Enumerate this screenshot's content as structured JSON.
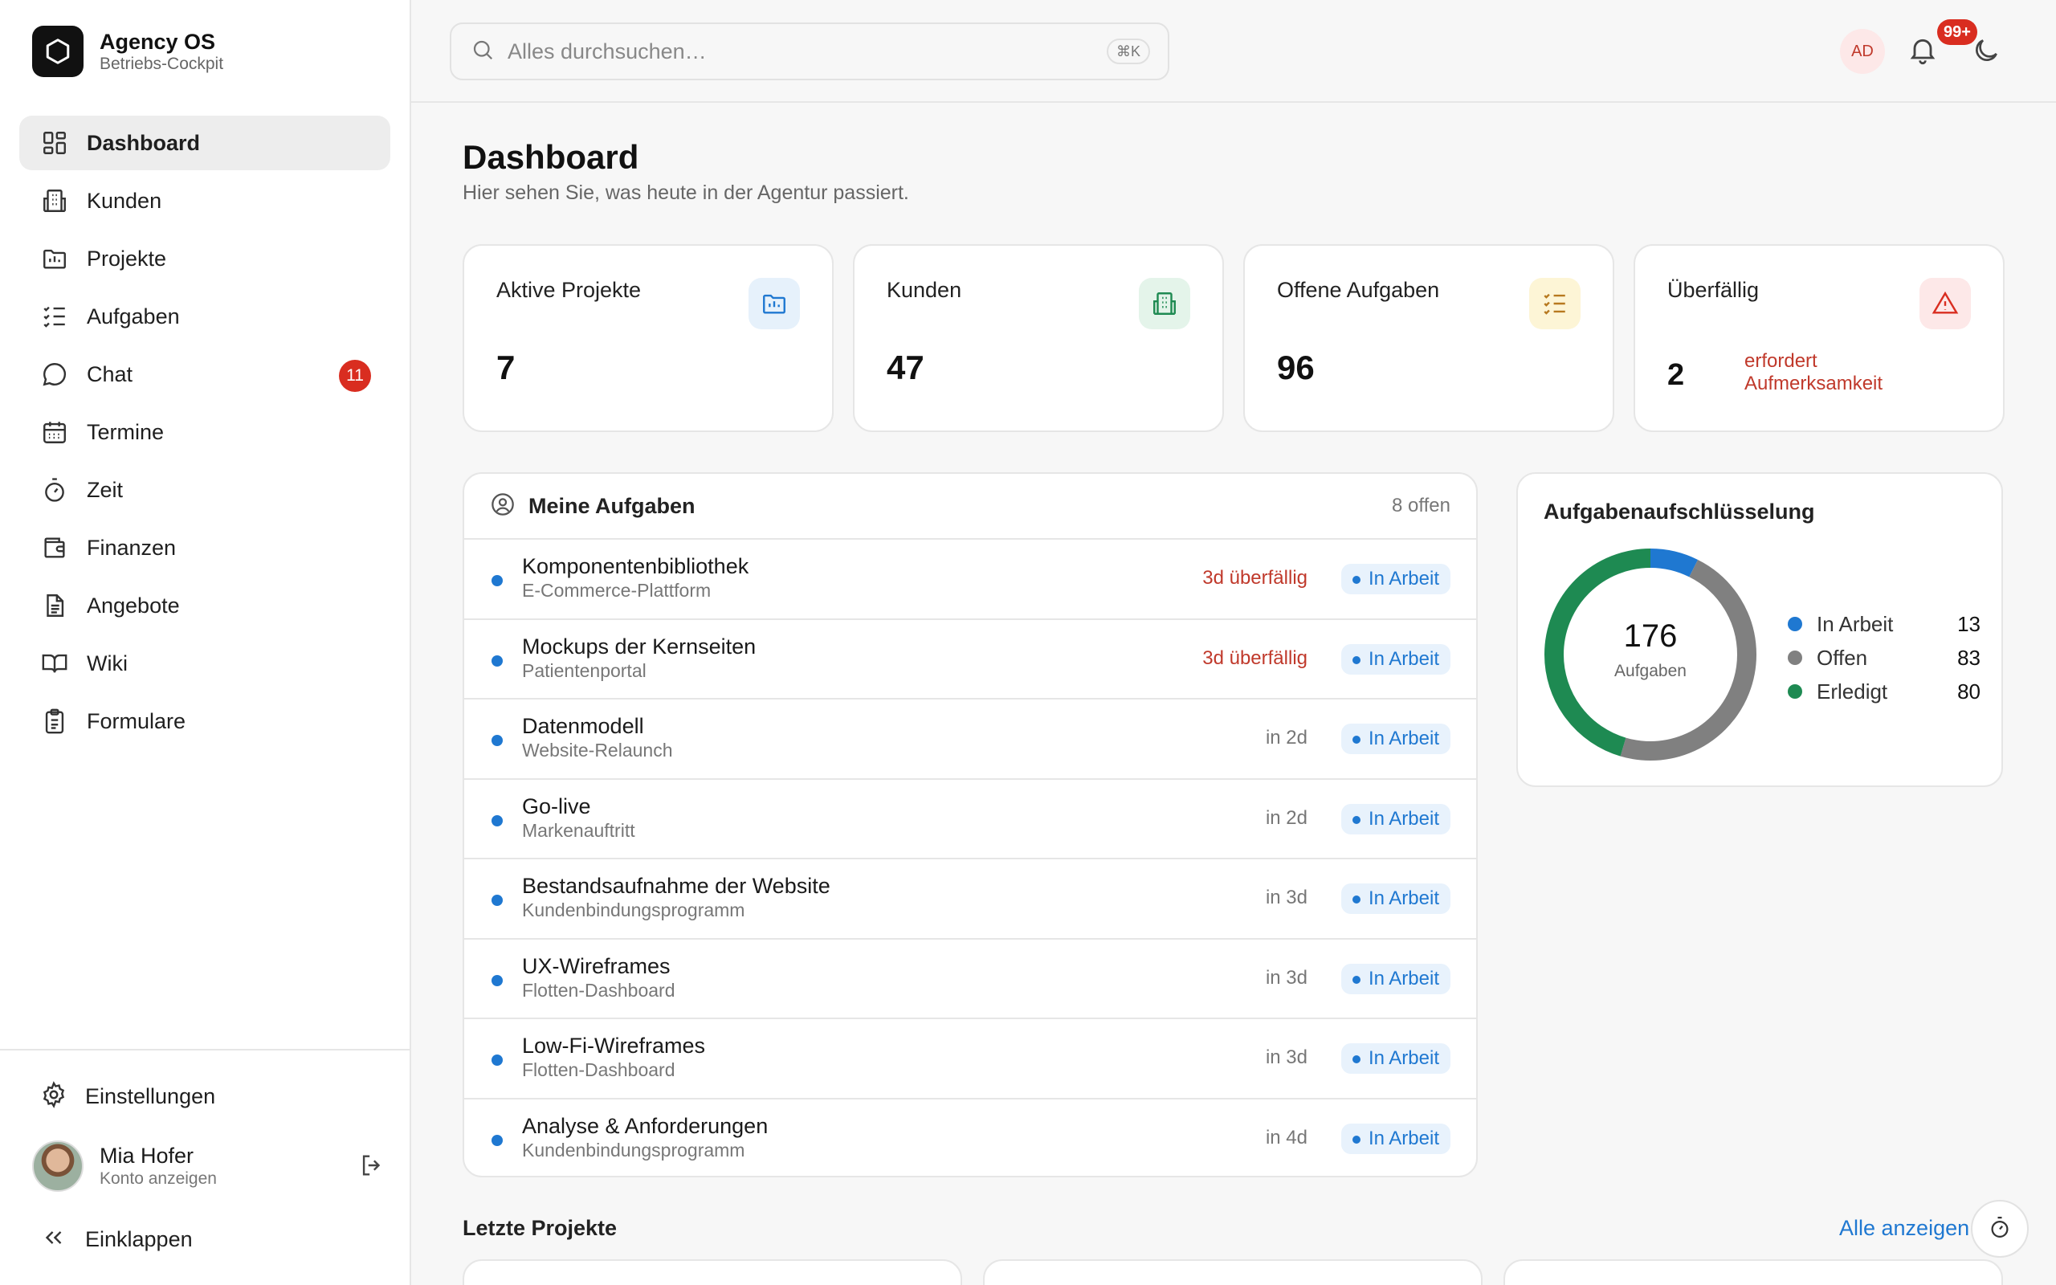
{
  "brand": {
    "name": "Agency OS",
    "subtitle": "Betriebs-Cockpit"
  },
  "nav": {
    "items": [
      {
        "label": "Dashboard",
        "icon": "dashboard-icon",
        "active": true
      },
      {
        "label": "Kunden",
        "icon": "building-icon"
      },
      {
        "label": "Projekte",
        "icon": "folder-chart-icon"
      },
      {
        "label": "Aufgaben",
        "icon": "list-check-icon"
      },
      {
        "label": "Chat",
        "icon": "chat-icon",
        "badge": "11"
      },
      {
        "label": "Termine",
        "icon": "calendar-icon"
      },
      {
        "label": "Zeit",
        "icon": "timer-icon"
      },
      {
        "label": "Finanzen",
        "icon": "wallet-icon"
      },
      {
        "label": "Angebote",
        "icon": "document-icon"
      },
      {
        "label": "Wiki",
        "icon": "book-icon"
      },
      {
        "label": "Formulare",
        "icon": "clipboard-icon"
      }
    ]
  },
  "footer": {
    "settings_label": "Einstellungen",
    "user_name": "Mia Hofer",
    "user_sub": "Konto anzeigen",
    "collapse_label": "Einklappen"
  },
  "topbar": {
    "search_placeholder": "Alles durchsuchen…",
    "search_shortcut": "⌘K",
    "avatar_initials": "AD",
    "notification_badge": "99+"
  },
  "page": {
    "title": "Dashboard",
    "subtitle": "Hier sehen Sie, was heute in der Agentur passiert."
  },
  "kpis": [
    {
      "label": "Aktive Projekte",
      "value": "7",
      "icon": "folder-chart-icon",
      "color": "#1f78d1",
      "bg": "#e6f1fb"
    },
    {
      "label": "Kunden",
      "value": "47",
      "icon": "building-icon",
      "color": "#1e8a52",
      "bg": "#e4f4ea"
    },
    {
      "label": "Offene Aufgaben",
      "value": "96",
      "icon": "list-check-icon",
      "color": "#b7791f",
      "bg": "#fdf5d6"
    },
    {
      "label": "Überfällig",
      "value": "2",
      "note": "erfordert Aufmerksamkeit",
      "icon": "warning-icon",
      "color": "#d92d20",
      "bg": "#fde8e8"
    }
  ],
  "tasks": {
    "title": "Meine Aufgaben",
    "count": "8 offen",
    "rows": [
      {
        "name": "Komponentenbibliothek",
        "project": "E-Commerce-Plattform",
        "due": "3d überfällig",
        "overdue": true,
        "status": "In Arbeit"
      },
      {
        "name": "Mockups der Kernseiten",
        "project": "Patientenportal",
        "due": "3d überfällig",
        "overdue": true,
        "status": "In Arbeit"
      },
      {
        "name": "Datenmodell",
        "project": "Website-Relaunch",
        "due": "in 2d",
        "overdue": false,
        "status": "In Arbeit"
      },
      {
        "name": "Go-live",
        "project": "Markenauftritt",
        "due": "in 2d",
        "overdue": false,
        "status": "In Arbeit"
      },
      {
        "name": "Bestandsaufnahme der Website",
        "project": "Kundenbindungsprogramm",
        "due": "in 3d",
        "overdue": false,
        "status": "In Arbeit"
      },
      {
        "name": "UX-Wireframes",
        "project": "Flotten-Dashboard",
        "due": "in 3d",
        "overdue": false,
        "status": "In Arbeit"
      },
      {
        "name": "Low-Fi-Wireframes",
        "project": "Flotten-Dashboard",
        "due": "in 3d",
        "overdue": false,
        "status": "In Arbeit"
      },
      {
        "name": "Analyse & Anforderungen",
        "project": "Kundenbindungsprogramm",
        "due": "in 4d",
        "overdue": false,
        "status": "In Arbeit"
      }
    ]
  },
  "breakdown": {
    "title": "Aufgabenaufschlüsselung",
    "total": "176",
    "total_caption": "Aufgaben",
    "segments": [
      {
        "label": "In Arbeit",
        "value": 13,
        "color": "#1f78d1"
      },
      {
        "label": "Offen",
        "value": 83,
        "color": "#808080"
      },
      {
        "label": "Erledigt",
        "value": 80,
        "color": "#1e8a52"
      }
    ]
  },
  "recent": {
    "title": "Letzte Projekte",
    "link": "Alle anzeigen"
  }
}
